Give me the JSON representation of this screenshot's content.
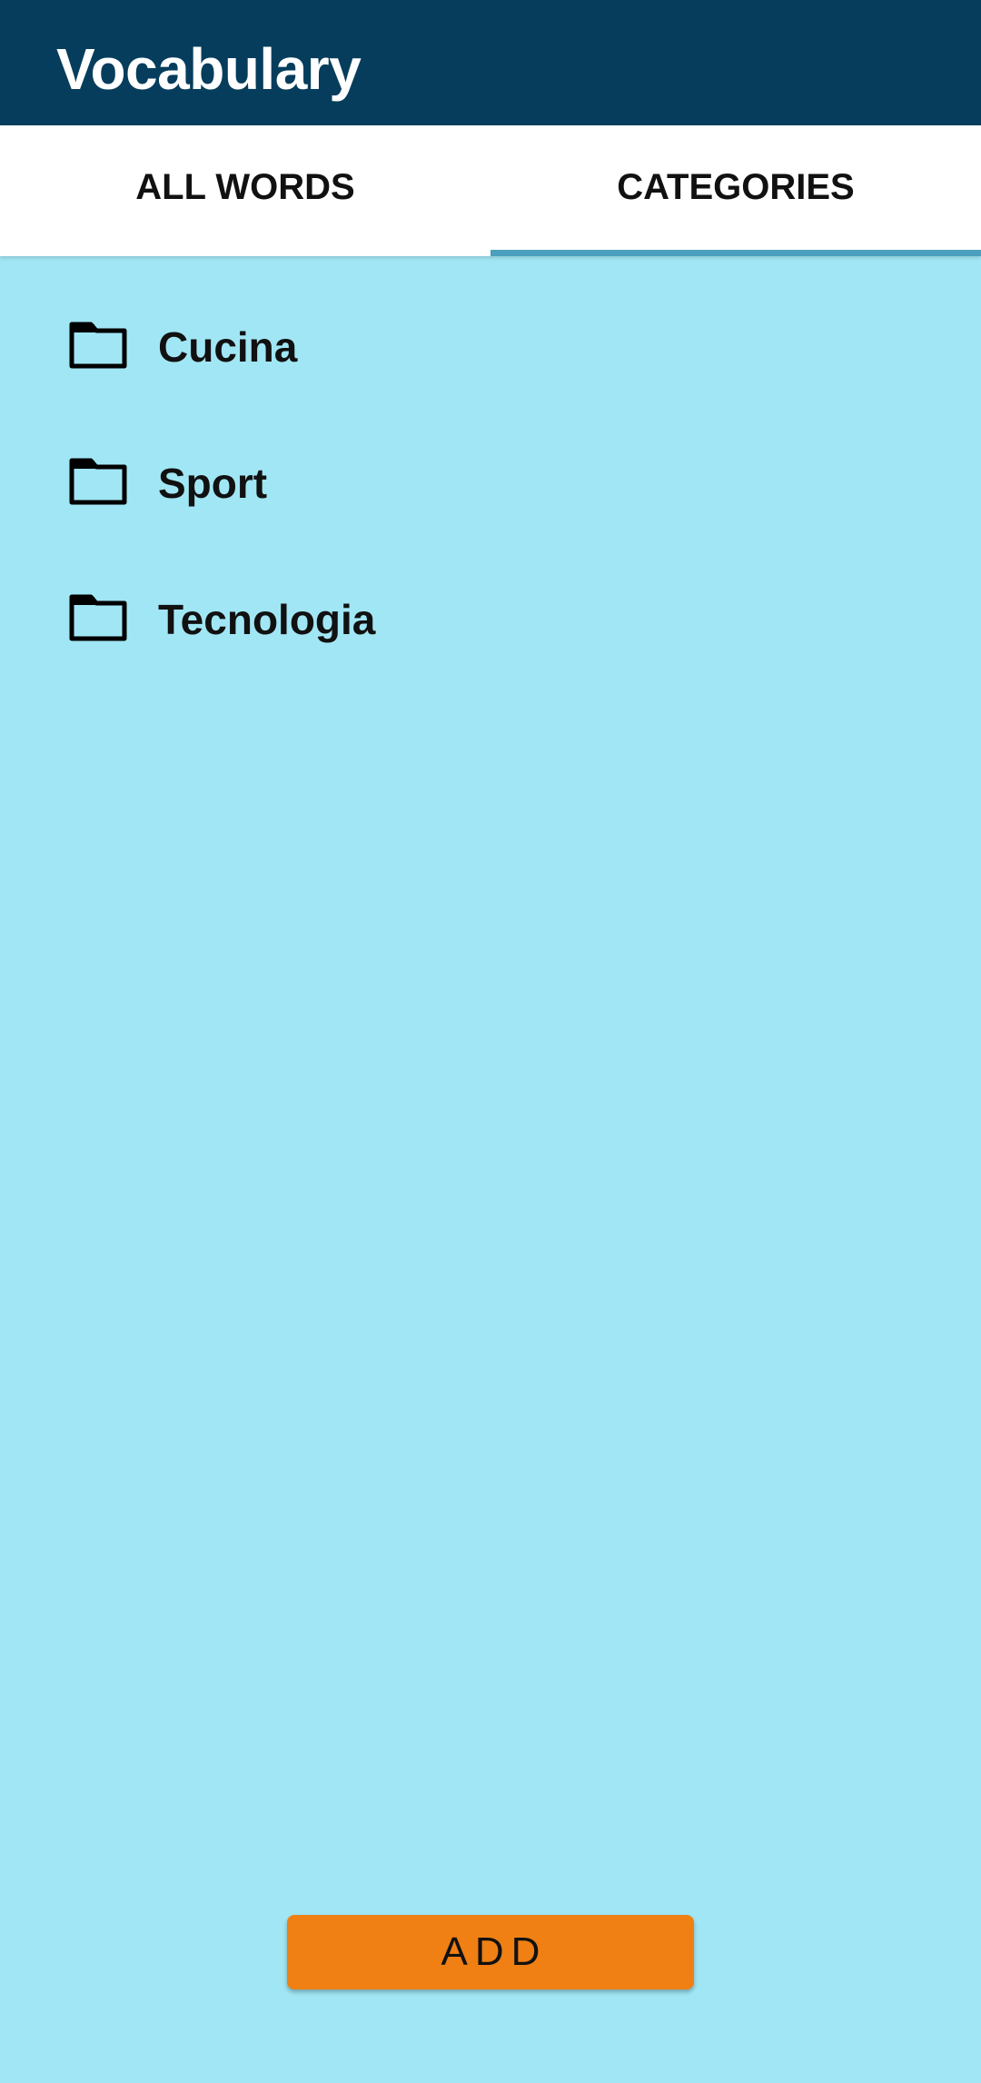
{
  "app_bar": {
    "title": "Vocabulary",
    "background_color": "#063d5c"
  },
  "tabs": [
    {
      "label": "ALL WORDS",
      "selected": false
    },
    {
      "label": "CATEGORIES",
      "selected": true
    }
  ],
  "tab_indicator_color": "#4aa0bd",
  "categories": {
    "icon": "folder-icon",
    "items": [
      {
        "label": "Cucina"
      },
      {
        "label": "Sport"
      },
      {
        "label": "Tecnologia"
      }
    ]
  },
  "content_background_color": "#a1e6f4",
  "add_button": {
    "label": "ADD",
    "color": "#f07f14"
  }
}
